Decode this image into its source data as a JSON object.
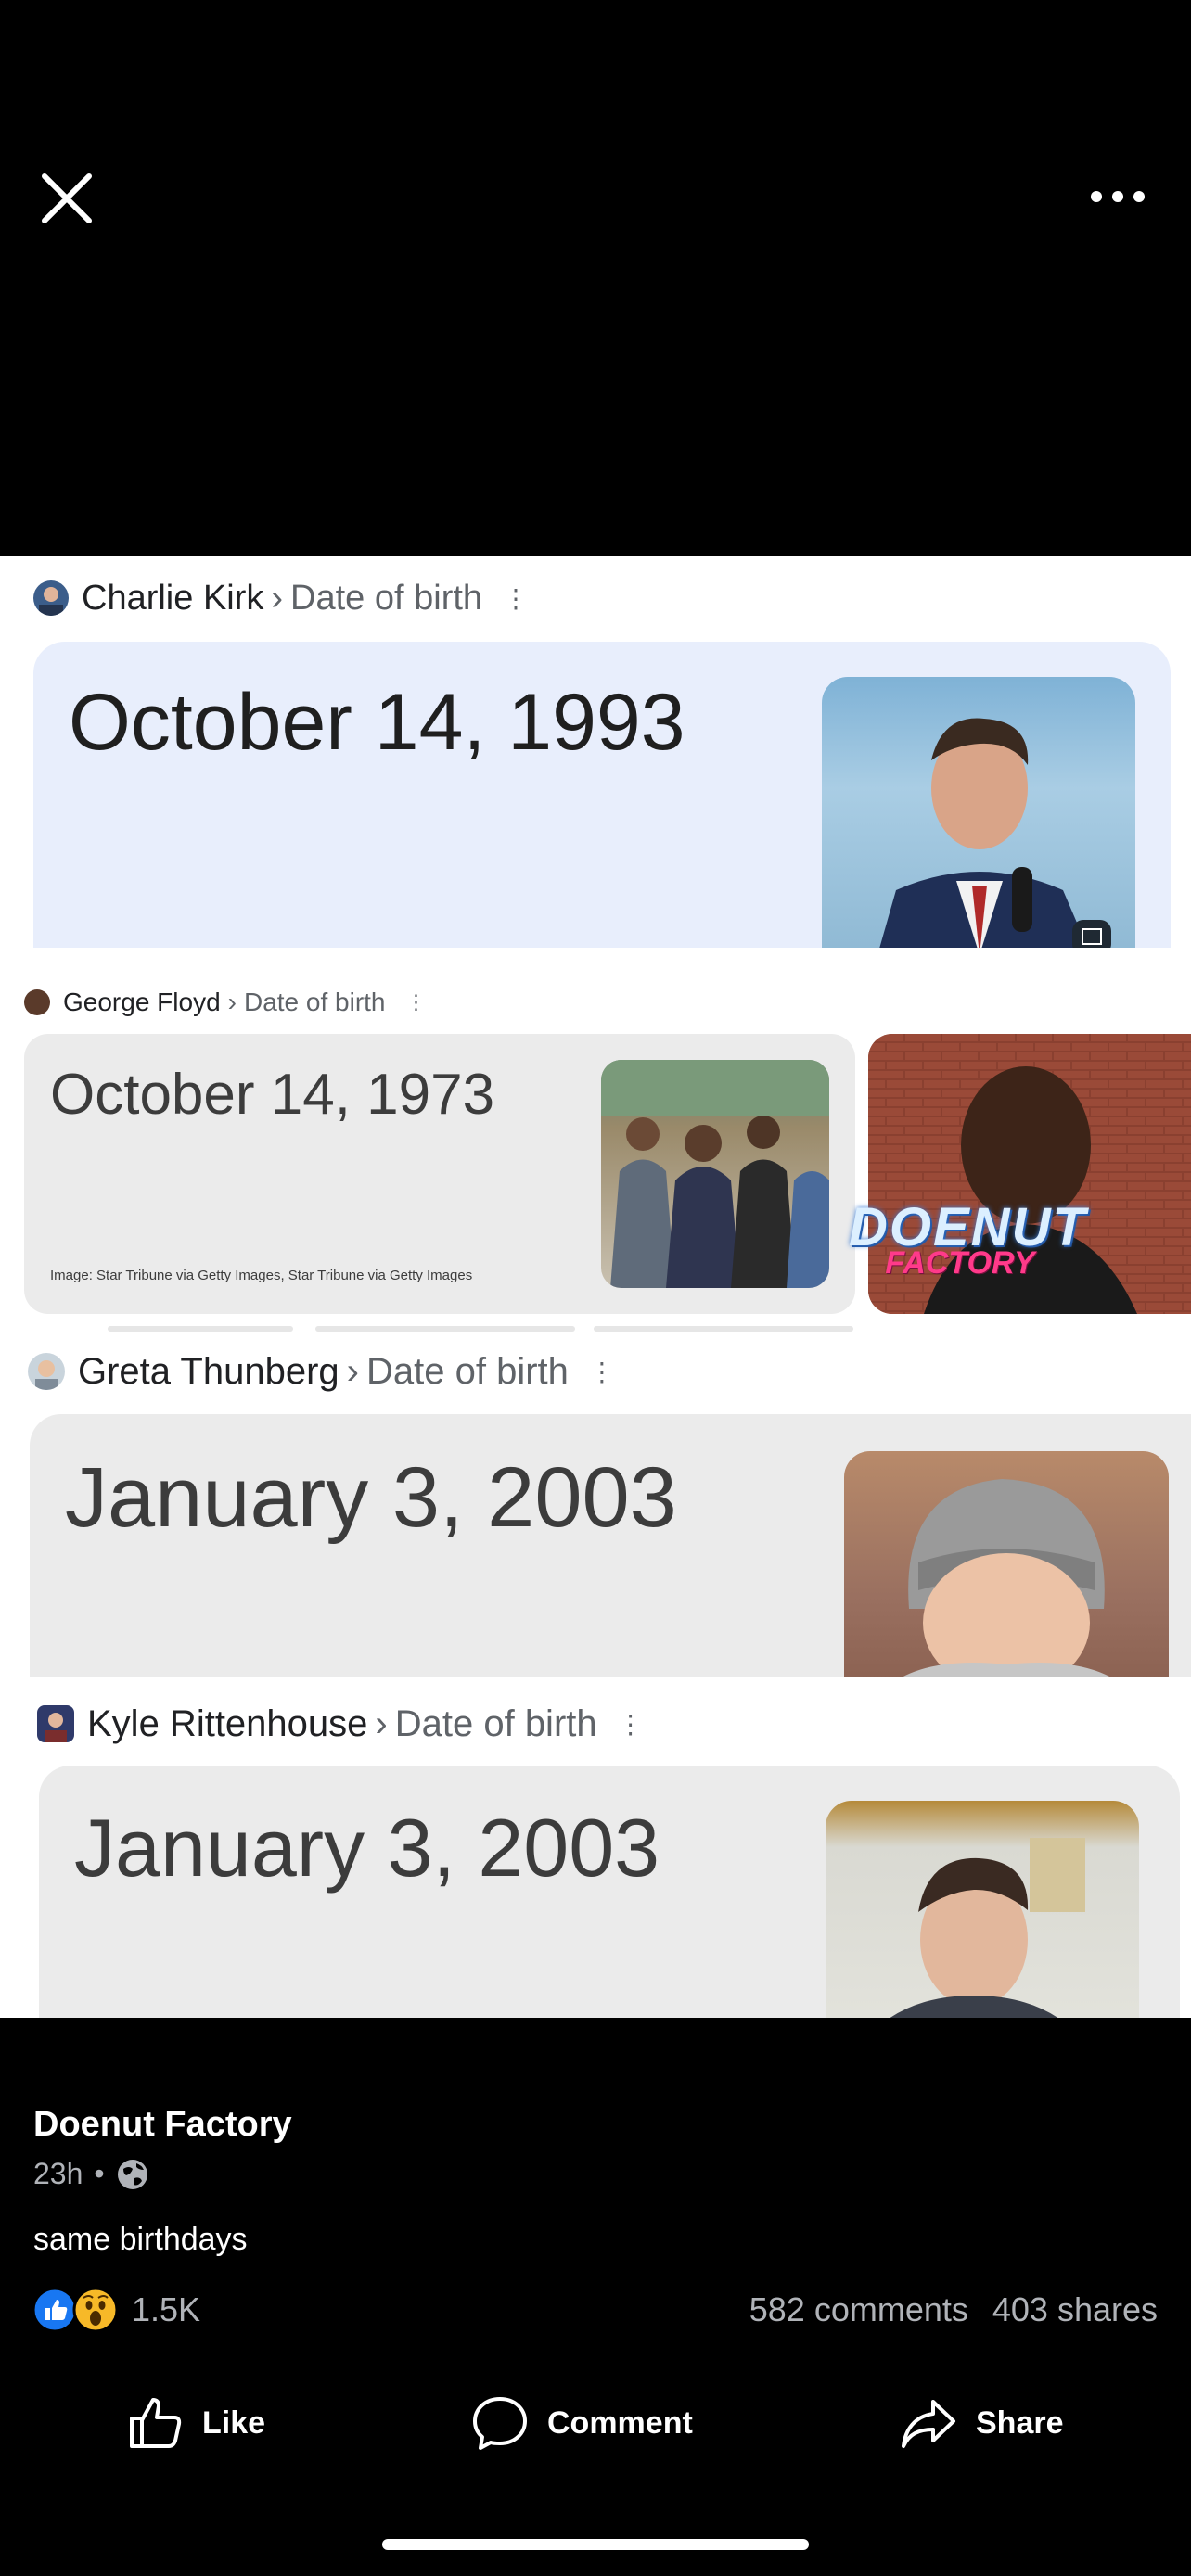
{
  "header": {
    "close_icon": "close-icon",
    "more_icon": "more-options-icon"
  },
  "results": [
    {
      "name": "Charlie Kirk",
      "sep": "›",
      "attribute": "Date of birth",
      "kebab": "⋮",
      "date": "October 14, 1993"
    },
    {
      "name": "George Floyd",
      "sep": "›",
      "attribute": "Date of birth",
      "kebab": "⋮",
      "date": "October 14, 1973",
      "image_credit": "Image: Star Tribune via Getty Images, Star Tribune via Getty Images",
      "watermark_line1": "DOENUT",
      "watermark_line2": "FACTORY"
    },
    {
      "name": "Greta Thunberg",
      "sep": "›",
      "attribute": "Date of birth",
      "kebab": "⋮",
      "date": "January 3, 2003"
    },
    {
      "name": "Kyle Rittenhouse",
      "sep": "›",
      "attribute": "Date of birth",
      "kebab": "⋮",
      "date": "January 3, 2003"
    }
  ],
  "post": {
    "author": "Doenut Factory",
    "time": "23h",
    "dot": "•",
    "audience_icon": "globe-icon",
    "caption": "same birthdays",
    "reactions": {
      "count": "1.5K",
      "icons": [
        "like-icon",
        "wow-icon"
      ]
    },
    "comments": "582 comments",
    "shares": "403 shares"
  },
  "actions": {
    "like": "Like",
    "comment": "Comment",
    "share": "Share"
  },
  "colors": {
    "background": "#000000",
    "card_blue": "#e8eefc",
    "card_grey": "#ebebeb",
    "like_blue": "#1877f2"
  }
}
